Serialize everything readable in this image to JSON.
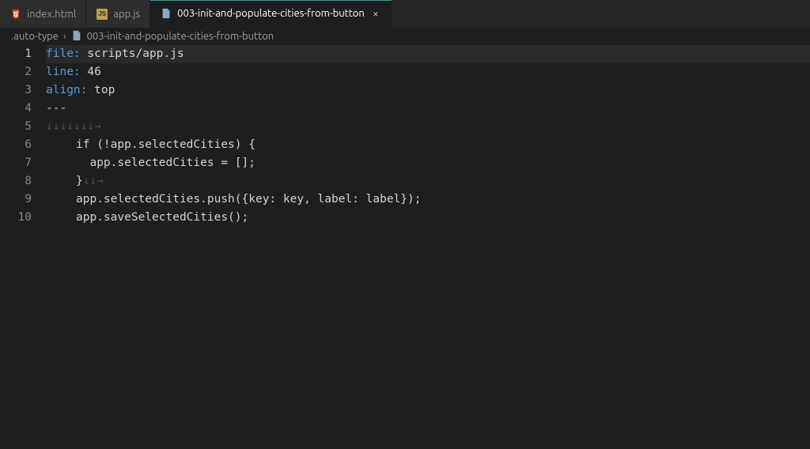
{
  "tabs": [
    {
      "label": "index.html",
      "icon": "html5"
    },
    {
      "label": "app.js",
      "icon": "js"
    },
    {
      "label": "003-init-and-populate-cities-from-button",
      "icon": "doc",
      "active": true,
      "closeable": true
    }
  ],
  "breadcrumb": {
    "seg0": ".auto-type",
    "seg1": "003-init-and-populate-cities-from-button"
  },
  "lines": {
    "n1": "1",
    "n2": "2",
    "n3": "3",
    "n4": "4",
    "n5": "5",
    "n6": "6",
    "n7": "7",
    "n8": "8",
    "n9": "9",
    "n10": "10"
  },
  "code": {
    "l1_key": "file:",
    "l1_val": " scripts/app.js",
    "l2_key": "line:",
    "l2_val": " 46",
    "l3_key": "align:",
    "l3_val": " top",
    "l4": "---",
    "l5_ws": "↓↓↓↓↓↓↓→",
    "l6": "if (!app.selectedCities) {",
    "l7": "app.selectedCities = [];",
    "l8a": "}",
    "l8b": "↓↓→",
    "l9": "app.selectedCities.push({key: key, label: label});",
    "l10": "app.saveSelectedCities();"
  }
}
